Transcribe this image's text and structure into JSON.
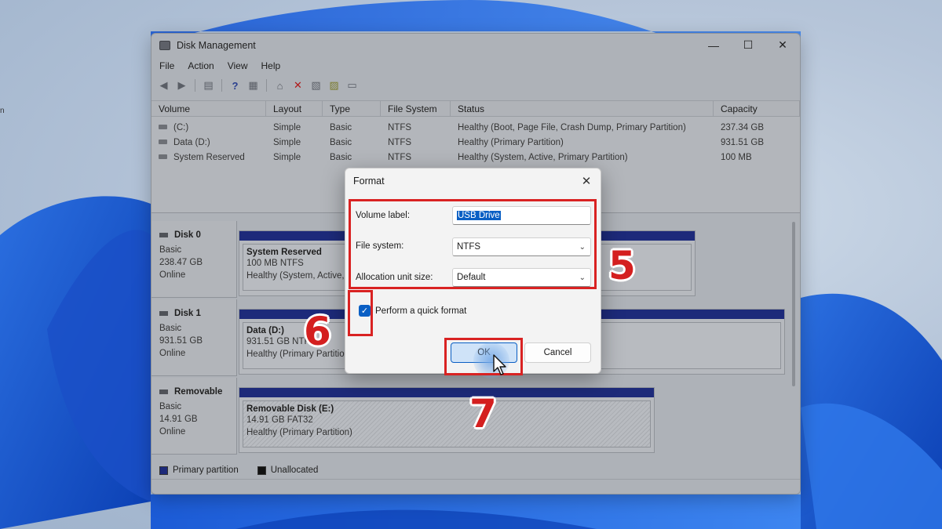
{
  "window": {
    "title": "Disk Management",
    "controls": {
      "minimize": "—",
      "maximize": "☐",
      "close": "✕"
    }
  },
  "menu": [
    "File",
    "Action",
    "View",
    "Help"
  ],
  "toolbar_icons": [
    "back-arrow-icon",
    "forward-arrow-icon",
    "console-tree-icon",
    "help-icon",
    "properties-icon",
    "connect-icon",
    "delete-icon",
    "new-volume-icon",
    "import-icon",
    "rescan-icon"
  ],
  "volume_list": {
    "headers": [
      "Volume",
      "Layout",
      "Type",
      "File System",
      "Status",
      "Capacity"
    ],
    "rows": [
      [
        "(C:)",
        "Simple",
        "Basic",
        "NTFS",
        "Healthy (Boot, Page File, Crash Dump, Primary Partition)",
        "237.34 GB"
      ],
      [
        "Data (D:)",
        "Simple",
        "Basic",
        "NTFS",
        "Healthy (Primary Partition)",
        "931.51 GB"
      ],
      [
        "System Reserved",
        "Simple",
        "Basic",
        "NTFS",
        "Healthy (System, Active, Primary Partition)",
        "100 MB"
      ]
    ]
  },
  "disks": [
    {
      "name": "Disk 0",
      "type": "Basic",
      "size": "238.47 GB",
      "state": "Online",
      "partition": {
        "name": "System Reserved",
        "detail": "100 MB NTFS",
        "status": "Healthy (System, Active,"
      }
    },
    {
      "name": "Disk 1",
      "type": "Basic",
      "size": "931.51 GB",
      "state": "Online",
      "partition": {
        "name": "Data  (D:)",
        "detail": "931.51 GB NTFS",
        "status": "Healthy (Primary Partition)"
      }
    },
    {
      "name": "Removable",
      "type": "Basic",
      "size": "14.91 GB",
      "state": "Online",
      "partition": {
        "name": "Removable Disk  (E:)",
        "detail": "14.91 GB FAT32",
        "status": "Healthy (Primary Partition)"
      }
    }
  ],
  "legend": [
    {
      "label": "Primary partition",
      "color": "#1d2a7a"
    },
    {
      "label": "Unallocated",
      "color": "#111111"
    }
  ],
  "dialog": {
    "title": "Format",
    "volume_label": {
      "label": "Volume label:",
      "value": "USB Drive"
    },
    "file_system": {
      "label": "File system:",
      "value": "NTFS"
    },
    "allocation": {
      "label": "Allocation unit size:",
      "value": "Default"
    },
    "quick_format": {
      "label": "Perform a quick format",
      "checked": true
    },
    "ok_label": "OK",
    "cancel_label": "Cancel"
  },
  "annotations": {
    "step5": "5",
    "step6": "6",
    "step7": "7",
    "color": "#d92222"
  },
  "colors": {
    "accent": "#0a5fc4",
    "partition_bar": "#1d2a7a"
  }
}
